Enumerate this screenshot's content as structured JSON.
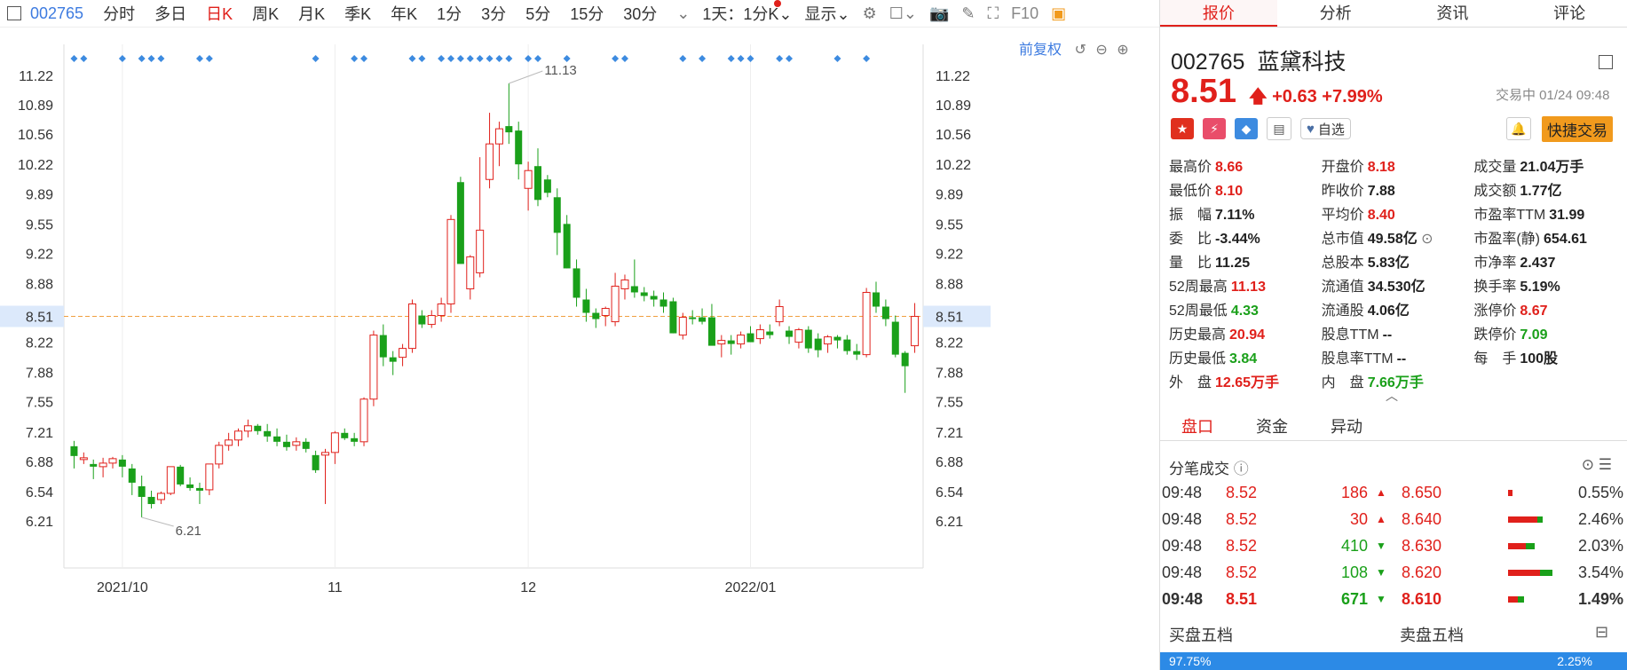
{
  "toolbar": {
    "code": "002765",
    "tabs": [
      "分时",
      "多日",
      "日K",
      "周K",
      "月K",
      "季K",
      "年K",
      "1分",
      "3分",
      "5分",
      "15分",
      "30分"
    ],
    "active_tab": "日K",
    "period_select": "1天：1分K",
    "display_select": "显示",
    "f10": "F10"
  },
  "chart_header": {
    "adjust_label": "前复权"
  },
  "chart_data": {
    "type": "candlestick",
    "y_ticks": [
      11.22,
      10.89,
      10.56,
      10.22,
      9.89,
      9.55,
      9.22,
      8.88,
      8.51,
      8.22,
      7.88,
      7.55,
      7.21,
      6.88,
      6.54,
      6.21
    ],
    "ylim": [
      5.7,
      11.7
    ],
    "current_price_line": 8.51,
    "x_labels": [
      "2021/10",
      "11",
      "12",
      "2022/01"
    ],
    "max_annotation": "11.13",
    "min_annotation": "6.21",
    "candles": [
      [
        7.05,
        7.11,
        6.8,
        6.94
      ],
      [
        6.9,
        6.98,
        6.85,
        6.92
      ],
      [
        6.85,
        6.9,
        6.68,
        6.82
      ],
      [
        6.82,
        6.92,
        6.7,
        6.86
      ],
      [
        6.86,
        6.93,
        6.8,
        6.91
      ],
      [
        6.9,
        6.95,
        6.7,
        6.82
      ],
      [
        6.8,
        6.85,
        6.5,
        6.64
      ],
      [
        6.6,
        6.72,
        6.25,
        6.48
      ],
      [
        6.48,
        6.55,
        6.35,
        6.4
      ],
      [
        6.45,
        6.54,
        6.4,
        6.52
      ],
      [
        6.52,
        6.82,
        6.5,
        6.82
      ],
      [
        6.82,
        6.84,
        6.6,
        6.62
      ],
      [
        6.62,
        6.7,
        6.55,
        6.58
      ],
      [
        6.58,
        6.64,
        6.4,
        6.55
      ],
      [
        6.56,
        6.85,
        6.5,
        6.85
      ],
      [
        6.85,
        7.1,
        6.8,
        7.06
      ],
      [
        7.06,
        7.2,
        7.0,
        7.12
      ],
      [
        7.12,
        7.25,
        7.05,
        7.22
      ],
      [
        7.22,
        7.35,
        7.15,
        7.28
      ],
      [
        7.28,
        7.3,
        7.18,
        7.22
      ],
      [
        7.22,
        7.3,
        7.1,
        7.16
      ],
      [
        7.16,
        7.25,
        7.05,
        7.1
      ],
      [
        7.1,
        7.18,
        7.0,
        7.04
      ],
      [
        7.06,
        7.15,
        7.0,
        7.1
      ],
      [
        7.1,
        7.14,
        6.98,
        7.02
      ],
      [
        6.95,
        7.0,
        6.75,
        6.78
      ],
      [
        6.95,
        7.02,
        6.4,
        6.98
      ],
      [
        6.98,
        7.22,
        6.85,
        7.2
      ],
      [
        7.2,
        7.25,
        7.12,
        7.14
      ],
      [
        7.14,
        7.2,
        7.05,
        7.1
      ],
      [
        7.1,
        7.6,
        7.05,
        7.58
      ],
      [
        7.58,
        8.35,
        7.5,
        8.3
      ],
      [
        8.3,
        8.42,
        7.95,
        8.05
      ],
      [
        8.05,
        8.12,
        7.85,
        8.0
      ],
      [
        8.05,
        8.2,
        7.95,
        8.15
      ],
      [
        8.15,
        8.7,
        8.1,
        8.65
      ],
      [
        8.52,
        8.58,
        8.38,
        8.42
      ],
      [
        8.42,
        8.58,
        8.38,
        8.52
      ],
      [
        8.52,
        8.72,
        8.45,
        8.65
      ],
      [
        8.65,
        9.65,
        8.55,
        9.6
      ],
      [
        10.02,
        10.08,
        9.1,
        9.1
      ],
      [
        8.82,
        9.2,
        8.7,
        9.18
      ],
      [
        9.0,
        10.3,
        8.95,
        9.48
      ],
      [
        10.05,
        10.8,
        9.95,
        10.45
      ],
      [
        10.45,
        10.7,
        10.2,
        10.62
      ],
      [
        10.65,
        11.13,
        10.45,
        10.58
      ],
      [
        10.6,
        10.7,
        10.05,
        10.22
      ],
      [
        9.95,
        10.25,
        9.7,
        10.15
      ],
      [
        10.2,
        10.4,
        9.75,
        9.82
      ],
      [
        10.05,
        10.1,
        9.85,
        9.9
      ],
      [
        9.85,
        9.95,
        9.2,
        9.45
      ],
      [
        9.55,
        9.65,
        9.05,
        9.05
      ],
      [
        9.05,
        9.15,
        8.62,
        8.72
      ],
      [
        8.7,
        8.82,
        8.45,
        8.55
      ],
      [
        8.55,
        8.6,
        8.38,
        8.48
      ],
      [
        8.52,
        8.62,
        8.4,
        8.6
      ],
      [
        8.45,
        9.0,
        8.4,
        8.85
      ],
      [
        8.82,
        8.98,
        8.7,
        8.92
      ],
      [
        8.85,
        9.15,
        8.72,
        8.78
      ],
      [
        8.78,
        8.84,
        8.68,
        8.74
      ],
      [
        8.74,
        8.8,
        8.62,
        8.7
      ],
      [
        8.7,
        8.78,
        8.55,
        8.62
      ],
      [
        8.68,
        8.72,
        8.32,
        8.32
      ],
      [
        8.3,
        8.55,
        8.25,
        8.5
      ],
      [
        8.5,
        8.58,
        8.42,
        8.48
      ],
      [
        8.5,
        8.6,
        8.42,
        8.45
      ],
      [
        8.5,
        8.65,
        8.2,
        8.18
      ],
      [
        8.2,
        8.3,
        8.05,
        8.24
      ],
      [
        8.24,
        8.3,
        8.08,
        8.2
      ],
      [
        8.2,
        8.34,
        8.15,
        8.3
      ],
      [
        8.32,
        8.4,
        8.25,
        8.22
      ],
      [
        8.26,
        8.42,
        8.2,
        8.36
      ],
      [
        8.34,
        8.42,
        8.26,
        8.3
      ],
      [
        8.45,
        8.7,
        8.4,
        8.62
      ],
      [
        8.35,
        8.4,
        8.2,
        8.28
      ],
      [
        8.22,
        8.38,
        8.15,
        8.36
      ],
      [
        8.36,
        8.4,
        8.1,
        8.15
      ],
      [
        8.26,
        8.32,
        8.05,
        8.13
      ],
      [
        8.2,
        8.3,
        8.1,
        8.28
      ],
      [
        8.28,
        8.3,
        8.15,
        8.24
      ],
      [
        8.25,
        8.3,
        8.08,
        8.12
      ],
      [
        8.12,
        8.2,
        8.02,
        8.08
      ],
      [
        8.08,
        8.83,
        8.05,
        8.78
      ],
      [
        8.78,
        8.9,
        8.55,
        8.62
      ],
      [
        8.62,
        8.7,
        8.4,
        8.48
      ],
      [
        8.45,
        8.52,
        8.05,
        8.08
      ],
      [
        8.1,
        8.12,
        7.65,
        7.95
      ],
      [
        8.18,
        8.66,
        8.1,
        8.51
      ]
    ],
    "markers": [
      0,
      1,
      5,
      7,
      8,
      9,
      13,
      14,
      25,
      29,
      30,
      35,
      36,
      38,
      39,
      40,
      41,
      42,
      43,
      44,
      45,
      47,
      48,
      51,
      56,
      57,
      63,
      65,
      68,
      69,
      70,
      73,
      74,
      79,
      82
    ]
  },
  "quote_tabs": [
    "报价",
    "分析",
    "资讯",
    "评论"
  ],
  "stock": {
    "code": "002765",
    "name": "蓝黛科技",
    "price": "8.51",
    "arrow": "🡅",
    "change": "+0.63",
    "change_pct": "+7.99%",
    "status": "交易中 01/24 09:48"
  },
  "buttons": {
    "watch": "自选",
    "quick_trade": "快捷交易"
  },
  "stats": [
    [
      {
        "k": "最高价",
        "v": "8.66",
        "c": "r"
      },
      {
        "k": "开盘价",
        "v": "8.18",
        "c": "r"
      },
      {
        "k": "成交量",
        "v": "21.04万手",
        "c": "d"
      }
    ],
    [
      {
        "k": "最低价",
        "v": "8.10",
        "c": "r"
      },
      {
        "k": "昨收价",
        "v": "7.88",
        "c": "d"
      },
      {
        "k": "成交额",
        "v": "1.77亿",
        "c": "d"
      }
    ],
    [
      {
        "k": "振　幅",
        "v": "7.11%",
        "c": "d"
      },
      {
        "k": "平均价",
        "v": "8.40",
        "c": "r"
      },
      {
        "k": "市盈率TTM",
        "v": "31.99",
        "c": "d"
      }
    ],
    [
      {
        "k": "委　比",
        "v": "-3.44%",
        "c": "d"
      },
      {
        "k": "总市值",
        "v": "49.58亿",
        "c": "d"
      },
      {
        "k": "市盈率(静)",
        "v": "654.61",
        "c": "d"
      }
    ],
    [
      {
        "k": "量　比",
        "v": "11.25",
        "c": "d"
      },
      {
        "k": "总股本",
        "v": "5.83亿",
        "c": "d"
      },
      {
        "k": "市净率",
        "v": "2.437",
        "c": "d"
      }
    ],
    [
      {
        "k": "52周最高",
        "v": "11.13",
        "c": "r"
      },
      {
        "k": "流通值",
        "v": "34.530亿",
        "c": "d"
      },
      {
        "k": "换手率",
        "v": "5.19%",
        "c": "d"
      }
    ],
    [
      {
        "k": "52周最低",
        "v": "4.33",
        "c": "g"
      },
      {
        "k": "流通股",
        "v": "4.06亿",
        "c": "d"
      },
      {
        "k": "涨停价",
        "v": "8.67",
        "c": "r"
      }
    ],
    [
      {
        "k": "历史最高",
        "v": "20.94",
        "c": "r"
      },
      {
        "k": "股息TTM",
        "v": "--",
        "c": "d"
      },
      {
        "k": "跌停价",
        "v": "7.09",
        "c": "g"
      }
    ],
    [
      {
        "k": "历史最低",
        "v": "3.84",
        "c": "g"
      },
      {
        "k": "股息率TTM",
        "v": "--",
        "c": "d"
      },
      {
        "k": "每　手",
        "v": "100股",
        "c": "d"
      }
    ],
    [
      {
        "k": "外　盘",
        "v": "12.65万手",
        "c": "r"
      },
      {
        "k": "内　盘",
        "v": "7.66万手",
        "c": "g"
      },
      {
        "k": "",
        "v": "",
        "c": "d"
      }
    ]
  ],
  "sub_tabs": [
    "盘口",
    "资金",
    "异动"
  ],
  "ticks_title": "分笔成交",
  "ticks": [
    {
      "t": "09:48",
      "p": "8.52",
      "vol": "186",
      "dir": "up",
      "lv": "8.650",
      "pct": "0.55%",
      "r": 0.1,
      "g": 0
    },
    {
      "t": "09:48",
      "p": "8.52",
      "vol": "30",
      "dir": "up",
      "lv": "8.640",
      "pct": "2.46%",
      "r": 0.65,
      "g": 0.12
    },
    {
      "t": "09:48",
      "p": "8.52",
      "vol": "410",
      "dir": "down",
      "lv": "8.630",
      "pct": "2.03%",
      "r": 0.4,
      "g": 0.2
    },
    {
      "t": "09:48",
      "p": "8.52",
      "vol": "108",
      "dir": "down",
      "lv": "8.620",
      "pct": "3.54%",
      "r": 0.72,
      "g": 0.28
    },
    {
      "t": "09:48",
      "p": "8.51",
      "vol": "671",
      "dir": "down",
      "lv": "8.610",
      "pct": "1.49%",
      "r": 0.22,
      "g": 0.14
    }
  ],
  "books": {
    "buy_label": "买盘五档",
    "sell_label": "卖盘五档",
    "buy_pct": "97.75%",
    "sell_pct": "2.25%"
  }
}
